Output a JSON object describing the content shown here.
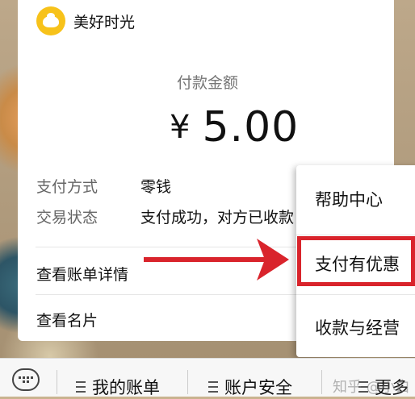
{
  "app": {
    "brand_name": "美好时光"
  },
  "payment": {
    "amount_label": "付款金额",
    "currency_symbol": "¥",
    "amount": "5.00"
  },
  "details": [
    {
      "key": "支付方式",
      "value": "零钱"
    },
    {
      "key": "交易状态",
      "value": "支付成功，对方已收款"
    }
  ],
  "links": {
    "bill_details": "查看账单详情",
    "business_card": "查看名片"
  },
  "menu": {
    "items": [
      "帮助中心",
      "支付有优惠",
      "收款与经营"
    ]
  },
  "toolbar": {
    "items": [
      "我的账单",
      "账户安全",
      "更多"
    ]
  },
  "watermark": "知乎 @小白",
  "colors": {
    "brand_yellow": "#f7c21a",
    "highlight_red": "#d9242c"
  }
}
